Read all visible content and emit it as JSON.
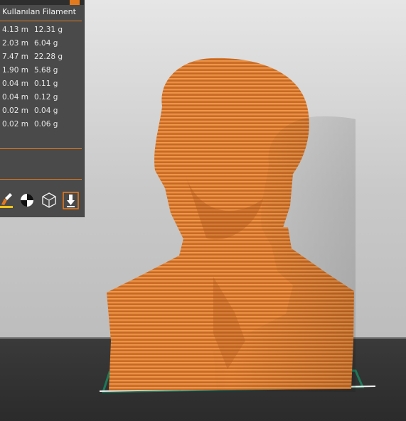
{
  "panel": {
    "header": "Kullanılan Filament",
    "rows": [
      {
        "length": "4.13 m",
        "weight": "12.31 g"
      },
      {
        "length": "2.03 m",
        "weight": "6.04 g"
      },
      {
        "length": "7.47 m",
        "weight": "22.28 g"
      },
      {
        "length": "1.90 m",
        "weight": "5.68 g"
      },
      {
        "length": "0.04 m",
        "weight": "0.11 g"
      },
      {
        "length": "0.04 m",
        "weight": "0.12 g"
      },
      {
        "length": "0.02 m",
        "weight": "0.04 g"
      },
      {
        "length": "0.02 m",
        "weight": "0.06 g"
      }
    ]
  },
  "toolbar": {
    "tools": [
      {
        "icon": "paint-brush-icon"
      },
      {
        "icon": "seam-painting-icon"
      },
      {
        "icon": "wireframe-cube-icon"
      },
      {
        "icon": "download-arrow-icon"
      }
    ]
  },
  "colors": {
    "accent": "#e47a1e",
    "model": "#d9772c",
    "panel_bg": "#4a4a4a",
    "floor": "#2e2e2e"
  }
}
